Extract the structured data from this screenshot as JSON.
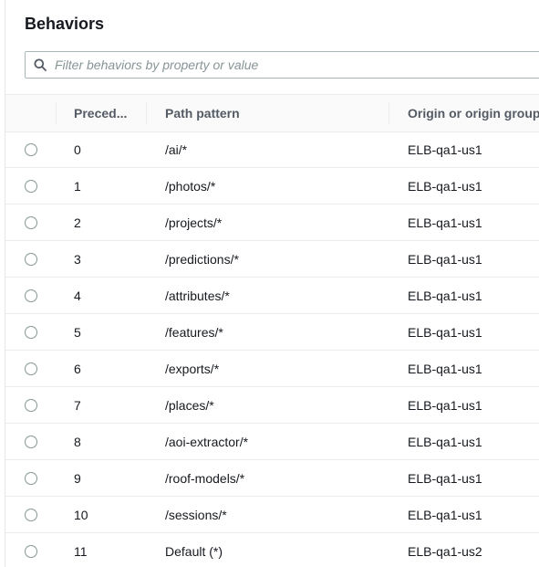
{
  "behaviors": {
    "title": "Behaviors",
    "search": {
      "placeholder": "Filter behaviors by property or value"
    },
    "columns": {
      "precedence": "Preced...",
      "path_pattern": "Path pattern",
      "origin": "Origin or origin group"
    },
    "rows": [
      {
        "precedence": "0",
        "path": "/ai/*",
        "origin": "ELB-qa1-us1"
      },
      {
        "precedence": "1",
        "path": "/photos/*",
        "origin": "ELB-qa1-us1"
      },
      {
        "precedence": "2",
        "path": "/projects/*",
        "origin": "ELB-qa1-us1"
      },
      {
        "precedence": "3",
        "path": "/predictions/*",
        "origin": "ELB-qa1-us1"
      },
      {
        "precedence": "4",
        "path": "/attributes/*",
        "origin": "ELB-qa1-us1"
      },
      {
        "precedence": "5",
        "path": "/features/*",
        "origin": "ELB-qa1-us1"
      },
      {
        "precedence": "6",
        "path": "/exports/*",
        "origin": "ELB-qa1-us1"
      },
      {
        "precedence": "7",
        "path": "/places/*",
        "origin": "ELB-qa1-us1"
      },
      {
        "precedence": "8",
        "path": "/aoi-extractor/*",
        "origin": "ELB-qa1-us1"
      },
      {
        "precedence": "9",
        "path": "/roof-models/*",
        "origin": "ELB-qa1-us1"
      },
      {
        "precedence": "10",
        "path": "/sessions/*",
        "origin": "ELB-qa1-us1"
      },
      {
        "precedence": "11",
        "path": "Default (*)",
        "origin": "ELB-qa1-us2"
      }
    ]
  },
  "icons": {
    "search": "search-icon",
    "row_select": "radio-button"
  },
  "colors": {
    "text": "#16191f",
    "header_text": "#545b64",
    "placeholder": "#879596",
    "divider": "#eaeded"
  }
}
